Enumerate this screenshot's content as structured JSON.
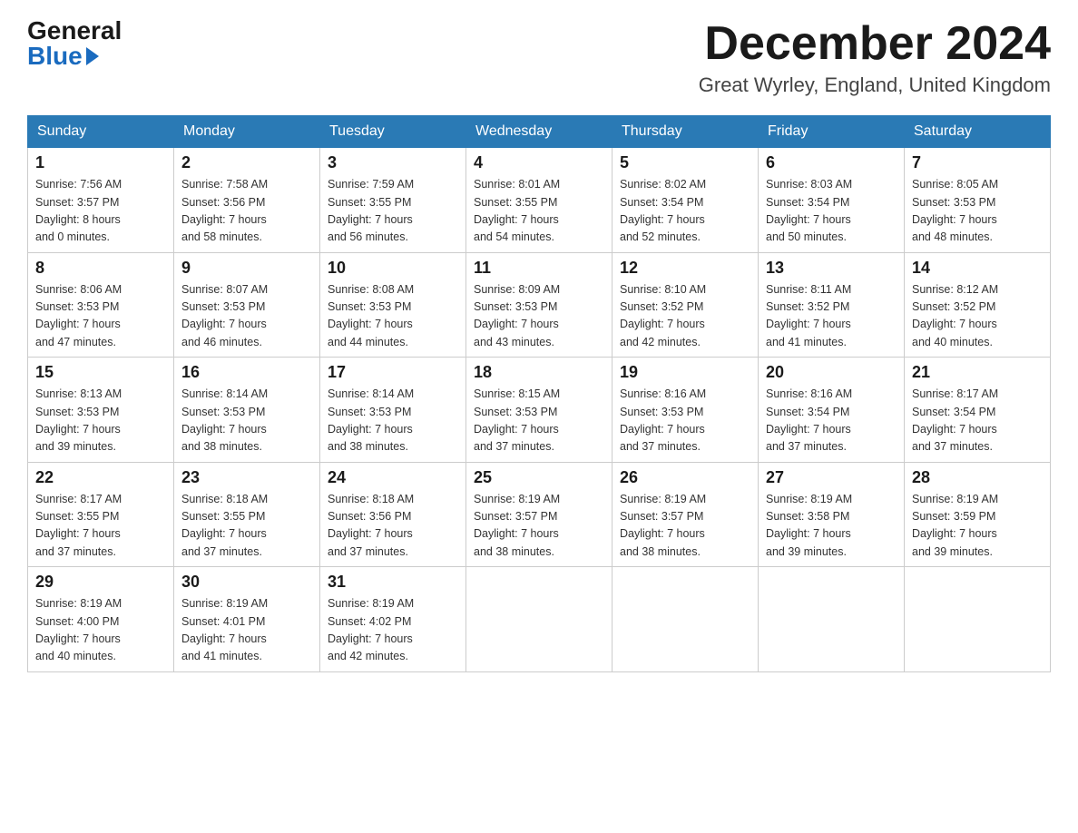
{
  "header": {
    "logo_general": "General",
    "logo_blue": "Blue",
    "month_title": "December 2024",
    "location": "Great Wyrley, England, United Kingdom"
  },
  "days_of_week": [
    "Sunday",
    "Monday",
    "Tuesday",
    "Wednesday",
    "Thursday",
    "Friday",
    "Saturday"
  ],
  "weeks": [
    [
      {
        "day": "1",
        "sunrise": "7:56 AM",
        "sunset": "3:57 PM",
        "daylight": "8 hours and 0 minutes."
      },
      {
        "day": "2",
        "sunrise": "7:58 AM",
        "sunset": "3:56 PM",
        "daylight": "7 hours and 58 minutes."
      },
      {
        "day": "3",
        "sunrise": "7:59 AM",
        "sunset": "3:55 PM",
        "daylight": "7 hours and 56 minutes."
      },
      {
        "day": "4",
        "sunrise": "8:01 AM",
        "sunset": "3:55 PM",
        "daylight": "7 hours and 54 minutes."
      },
      {
        "day": "5",
        "sunrise": "8:02 AM",
        "sunset": "3:54 PM",
        "daylight": "7 hours and 52 minutes."
      },
      {
        "day": "6",
        "sunrise": "8:03 AM",
        "sunset": "3:54 PM",
        "daylight": "7 hours and 50 minutes."
      },
      {
        "day": "7",
        "sunrise": "8:05 AM",
        "sunset": "3:53 PM",
        "daylight": "7 hours and 48 minutes."
      }
    ],
    [
      {
        "day": "8",
        "sunrise": "8:06 AM",
        "sunset": "3:53 PM",
        "daylight": "7 hours and 47 minutes."
      },
      {
        "day": "9",
        "sunrise": "8:07 AM",
        "sunset": "3:53 PM",
        "daylight": "7 hours and 46 minutes."
      },
      {
        "day": "10",
        "sunrise": "8:08 AM",
        "sunset": "3:53 PM",
        "daylight": "7 hours and 44 minutes."
      },
      {
        "day": "11",
        "sunrise": "8:09 AM",
        "sunset": "3:53 PM",
        "daylight": "7 hours and 43 minutes."
      },
      {
        "day": "12",
        "sunrise": "8:10 AM",
        "sunset": "3:52 PM",
        "daylight": "7 hours and 42 minutes."
      },
      {
        "day": "13",
        "sunrise": "8:11 AM",
        "sunset": "3:52 PM",
        "daylight": "7 hours and 41 minutes."
      },
      {
        "day": "14",
        "sunrise": "8:12 AM",
        "sunset": "3:52 PM",
        "daylight": "7 hours and 40 minutes."
      }
    ],
    [
      {
        "day": "15",
        "sunrise": "8:13 AM",
        "sunset": "3:53 PM",
        "daylight": "7 hours and 39 minutes."
      },
      {
        "day": "16",
        "sunrise": "8:14 AM",
        "sunset": "3:53 PM",
        "daylight": "7 hours and 38 minutes."
      },
      {
        "day": "17",
        "sunrise": "8:14 AM",
        "sunset": "3:53 PM",
        "daylight": "7 hours and 38 minutes."
      },
      {
        "day": "18",
        "sunrise": "8:15 AM",
        "sunset": "3:53 PM",
        "daylight": "7 hours and 37 minutes."
      },
      {
        "day": "19",
        "sunrise": "8:16 AM",
        "sunset": "3:53 PM",
        "daylight": "7 hours and 37 minutes."
      },
      {
        "day": "20",
        "sunrise": "8:16 AM",
        "sunset": "3:54 PM",
        "daylight": "7 hours and 37 minutes."
      },
      {
        "day": "21",
        "sunrise": "8:17 AM",
        "sunset": "3:54 PM",
        "daylight": "7 hours and 37 minutes."
      }
    ],
    [
      {
        "day": "22",
        "sunrise": "8:17 AM",
        "sunset": "3:55 PM",
        "daylight": "7 hours and 37 minutes."
      },
      {
        "day": "23",
        "sunrise": "8:18 AM",
        "sunset": "3:55 PM",
        "daylight": "7 hours and 37 minutes."
      },
      {
        "day": "24",
        "sunrise": "8:18 AM",
        "sunset": "3:56 PM",
        "daylight": "7 hours and 37 minutes."
      },
      {
        "day": "25",
        "sunrise": "8:19 AM",
        "sunset": "3:57 PM",
        "daylight": "7 hours and 38 minutes."
      },
      {
        "day": "26",
        "sunrise": "8:19 AM",
        "sunset": "3:57 PM",
        "daylight": "7 hours and 38 minutes."
      },
      {
        "day": "27",
        "sunrise": "8:19 AM",
        "sunset": "3:58 PM",
        "daylight": "7 hours and 39 minutes."
      },
      {
        "day": "28",
        "sunrise": "8:19 AM",
        "sunset": "3:59 PM",
        "daylight": "7 hours and 39 minutes."
      }
    ],
    [
      {
        "day": "29",
        "sunrise": "8:19 AM",
        "sunset": "4:00 PM",
        "daylight": "7 hours and 40 minutes."
      },
      {
        "day": "30",
        "sunrise": "8:19 AM",
        "sunset": "4:01 PM",
        "daylight": "7 hours and 41 minutes."
      },
      {
        "day": "31",
        "sunrise": "8:19 AM",
        "sunset": "4:02 PM",
        "daylight": "7 hours and 42 minutes."
      },
      null,
      null,
      null,
      null
    ]
  ]
}
